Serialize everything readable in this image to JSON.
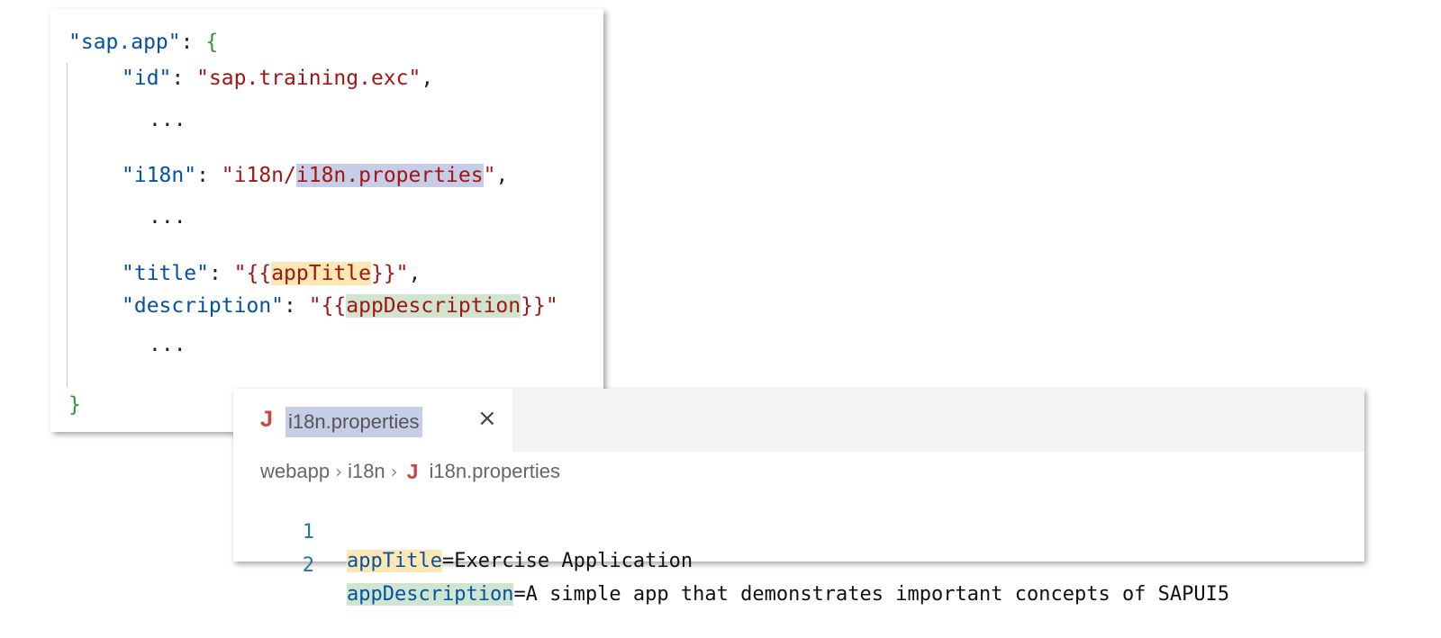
{
  "json_snippet": {
    "open": {
      "key": "\"sap.app\"",
      "colon": ": ",
      "brace": "{"
    },
    "id": {
      "key": "\"id\"",
      "colon": ": ",
      "value": "\"sap.training.exc\"",
      "comma": ","
    },
    "ellipsis": "...",
    "i18n": {
      "key": "\"i18n\"",
      "colon": ": ",
      "value_prefix": "\"i18n/",
      "value_highlight": "i18n.properties",
      "value_suffix": "\"",
      "comma": ","
    },
    "title": {
      "key": "\"title\"",
      "colon": ": ",
      "value_prefix": "\"{{",
      "value_highlight": "appTitle",
      "value_suffix": "}}\"",
      "comma": ","
    },
    "description": {
      "key": "\"description\"",
      "colon": ": ",
      "value_prefix": "\"{{",
      "value_highlight": "appDescription",
      "value_suffix": "}}\""
    },
    "close": "}"
  },
  "editor": {
    "tab": {
      "icon": "J",
      "label": "i18n.properties",
      "close": "×"
    },
    "breadcrumb": [
      "webapp",
      "i18n",
      "i18n.properties"
    ],
    "breadcrumb_sep": "›",
    "lines": [
      {
        "number": "1",
        "key": "appTitle",
        "rest": "=Exercise Application"
      },
      {
        "number": "2",
        "key": "appDescription",
        "rest": "=A simple app that demonstrates important concepts of SAPUI5"
      }
    ]
  }
}
